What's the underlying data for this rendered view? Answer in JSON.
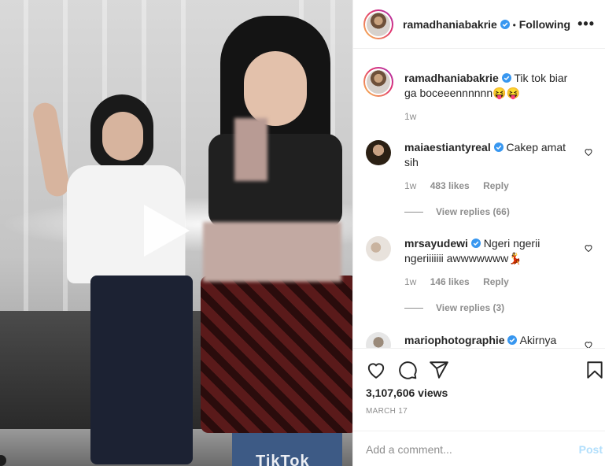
{
  "post": {
    "author": "ramadhaniabakrie",
    "follow_state": "Following",
    "separator": "•",
    "more_glyph": "•••",
    "media_watermark": "TikTok"
  },
  "caption": {
    "username": "ramadhaniabakrie",
    "text": "Tik tok biar ga boceeennnnnn😝😝",
    "time": "1w"
  },
  "comments": [
    {
      "username": "maiaestiantyreal",
      "text": "Cakep amat sih",
      "time": "1w",
      "likes": "483 likes",
      "reply": "Reply",
      "view_replies": "View replies (66)"
    },
    {
      "username": "mrsayudewi",
      "text": "Ngeri ngerii ngeriiiiiii awwwwwww💃",
      "time": "1w",
      "likes": "146 likes",
      "reply": "Reply",
      "view_replies": "View replies (3)"
    },
    {
      "username": "mariophotographie",
      "text": "Akirnya"
    }
  ],
  "stats": {
    "views": "3,107,606 views",
    "date": "MARCH 17"
  },
  "add_comment": {
    "placeholder": "Add a comment...",
    "post_label": "Post"
  },
  "icons": {
    "play": "play-icon",
    "verified": "verified-badge-icon",
    "heart": "heart-icon",
    "comment": "comment-icon",
    "share": "paper-plane-icon",
    "save": "bookmark-icon"
  },
  "colors": {
    "verified": "#3897f0",
    "post_button": "#b2dffc",
    "muted_text": "#8e8e8e"
  }
}
